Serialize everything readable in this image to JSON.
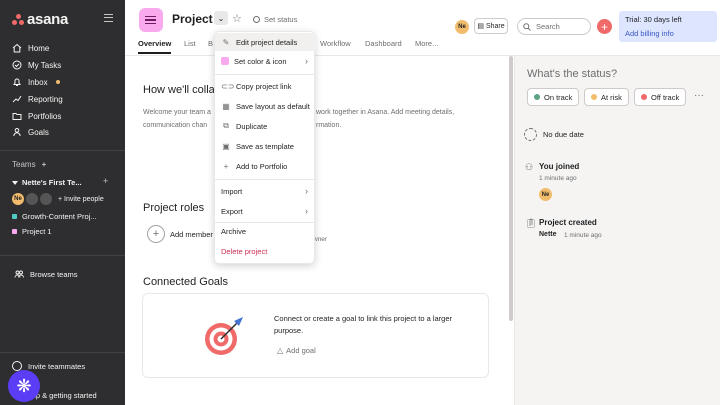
{
  "sidebar": {
    "brand": "asana",
    "nav": [
      {
        "label": "Home"
      },
      {
        "label": "My Tasks"
      },
      {
        "label": "Inbox"
      },
      {
        "label": "Reporting"
      },
      {
        "label": "Portfolios"
      },
      {
        "label": "Goals"
      }
    ],
    "teams_label": "Teams",
    "team_name": "Nette's First Te...",
    "avatar_initials": "Ne",
    "invite_people": "Invite people",
    "projects": [
      {
        "label": "Growth-Content Proj...",
        "color": "#4ecbc4"
      },
      {
        "label": "Project 1",
        "color": "#f9aaef"
      }
    ],
    "browse_teams": "Browse teams",
    "invite_teammates": "Invite teammates",
    "help": "elp & getting started"
  },
  "header": {
    "title": "Project 1",
    "set_status": "Set status",
    "avatar_initials": "Ne",
    "share": "Share",
    "search_placeholder": "Search",
    "trial_line1": "Trial: 30 days left",
    "trial_line2": "Add billing info",
    "tabs": [
      {
        "label": "Overview"
      },
      {
        "label": "List"
      },
      {
        "label": "B"
      },
      {
        "label": "Workflow"
      },
      {
        "label": "Dashboard"
      },
      {
        "label": "More..."
      }
    ]
  },
  "main": {
    "collab_title": "How we'll colla",
    "desc_line1": "Welcome your team a",
    "desc_line1b": "work together in Asana. Add meeting details,",
    "desc_line2": "communication chan",
    "desc_line2b": "rmation.",
    "roles_title": "Project roles",
    "add_member": "Add member",
    "owner": "wner",
    "goals_title": "Connected Goals",
    "goals_text": "Connect or create a goal to link this project to a larger purpose.",
    "add_goal": "Add goal"
  },
  "status_panel": {
    "title": "What's the status?",
    "buttons": [
      {
        "label": "On track",
        "color": "#5da283"
      },
      {
        "label": "At risk",
        "color": "#f1bd6c"
      },
      {
        "label": "Off track",
        "color": "#f06a6a"
      }
    ],
    "no_due_date": "No due date",
    "activity1": "You joined",
    "activity1_time": "1 minute ago",
    "avatar_initials": "Ne",
    "activity2": "Project created",
    "activity2_user": "Nette",
    "activity2_time": "1 minute ago"
  },
  "menu": {
    "items": [
      {
        "label": "Edit project details"
      },
      {
        "label": "Set color & icon"
      },
      {
        "label": "Copy project link"
      },
      {
        "label": "Save layout as default"
      },
      {
        "label": "Duplicate"
      },
      {
        "label": "Save as template"
      },
      {
        "label": "Add to Portfolio"
      },
      {
        "label": "Import"
      },
      {
        "label": "Export"
      },
      {
        "label": "Archive"
      },
      {
        "label": "Delete project"
      }
    ]
  }
}
